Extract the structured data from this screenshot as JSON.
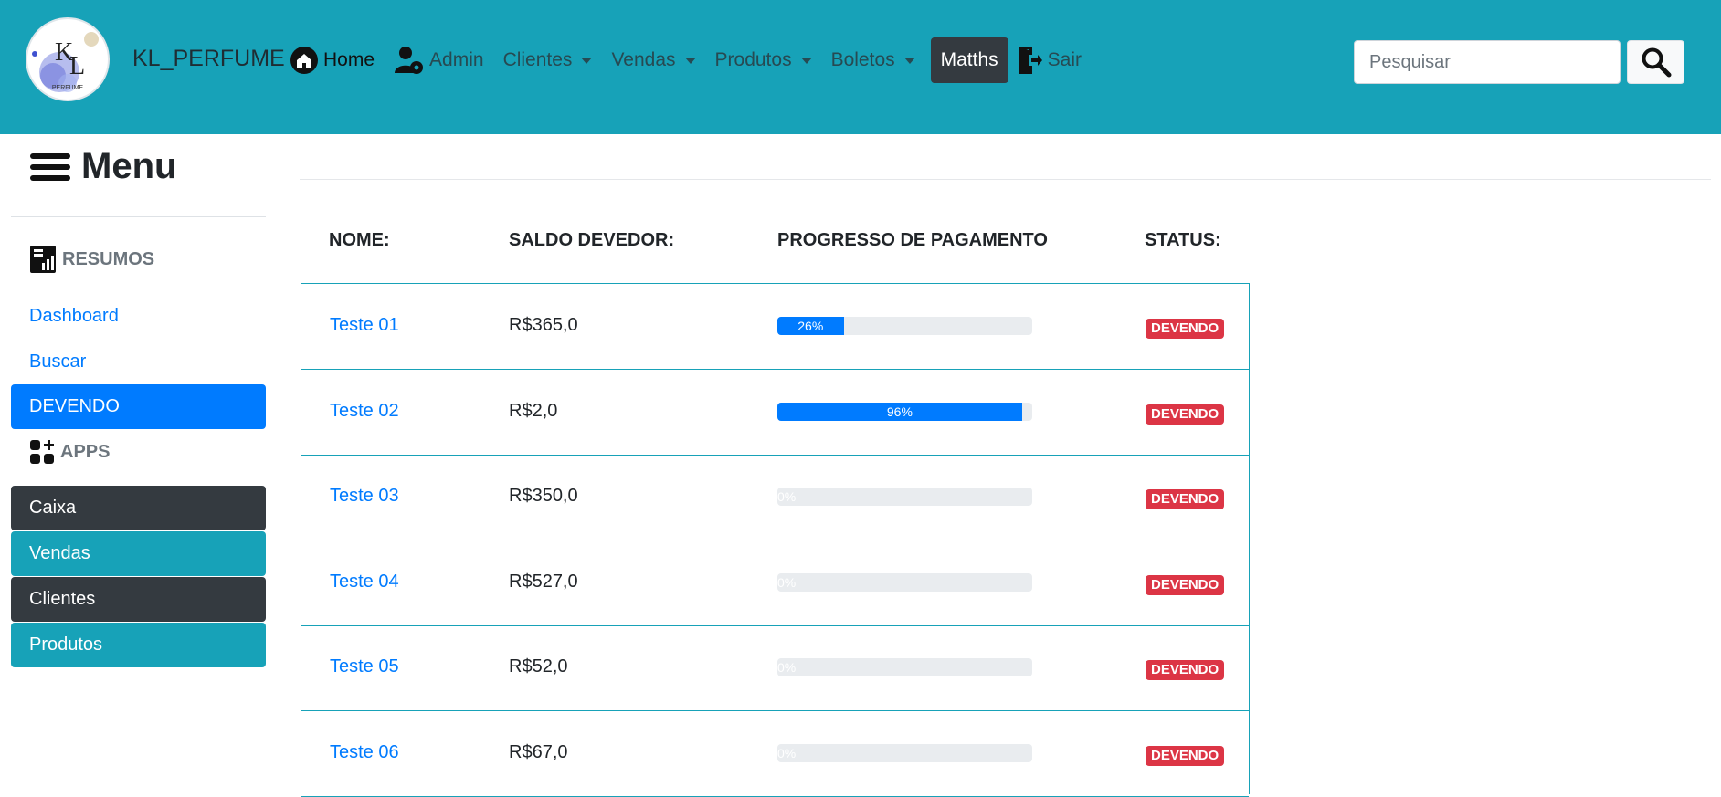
{
  "brand": {
    "name": "KL_PERFUME",
    "logo_text": "KL",
    "logo_subtext": "PERFUME"
  },
  "nav": {
    "items": [
      {
        "label": "Home",
        "icon": "home-icon"
      },
      {
        "label": "Admin",
        "icon": "user-gear-icon"
      },
      {
        "label": "Clientes",
        "dropdown": true
      },
      {
        "label": "Vendas",
        "dropdown": true
      },
      {
        "label": "Produtos",
        "dropdown": true
      },
      {
        "label": "Boletos",
        "dropdown": true
      },
      {
        "label": "Matths",
        "active": true
      },
      {
        "label": "Sair",
        "icon": "logout-icon"
      }
    ],
    "search_placeholder": "Pesquisar",
    "search_icon": "search-icon"
  },
  "sidebar": {
    "title": "Menu",
    "resumos_label": "RESUMOS",
    "links": [
      "Dashboard",
      "Buscar"
    ],
    "active": "DEVENDO",
    "apps_label": "APPS",
    "apps": [
      "Caixa",
      "Vendas",
      "Clientes",
      "Produtos"
    ]
  },
  "table": {
    "headers": [
      "NOME:",
      "SALDO DEVEDOR:",
      "PROGRESSO DE PAGAMENTO",
      "STATUS:"
    ],
    "rows": [
      {
        "name": "Teste 01",
        "saldo": "R$365,0",
        "progress": 26,
        "progress_label": "26%",
        "status": "DEVENDO"
      },
      {
        "name": "Teste 02",
        "saldo": "R$2,0",
        "progress": 96,
        "progress_label": "96%",
        "status": "DEVENDO"
      },
      {
        "name": "Teste 03",
        "saldo": "R$350,0",
        "progress": 0,
        "progress_label": "0%",
        "status": "DEVENDO"
      },
      {
        "name": "Teste 04",
        "saldo": "R$527,0",
        "progress": 0,
        "progress_label": "0%",
        "status": "DEVENDO"
      },
      {
        "name": "Teste 05",
        "saldo": "R$52,0",
        "progress": 0,
        "progress_label": "0%",
        "status": "DEVENDO"
      },
      {
        "name": "Teste 06",
        "saldo": "R$67,0",
        "progress": 0,
        "progress_label": "0%",
        "status": "DEVENDO"
      }
    ]
  },
  "colors": {
    "navbar": "#17a2b8",
    "primary": "#007bff",
    "dark": "#343a40",
    "danger": "#dc3545"
  }
}
